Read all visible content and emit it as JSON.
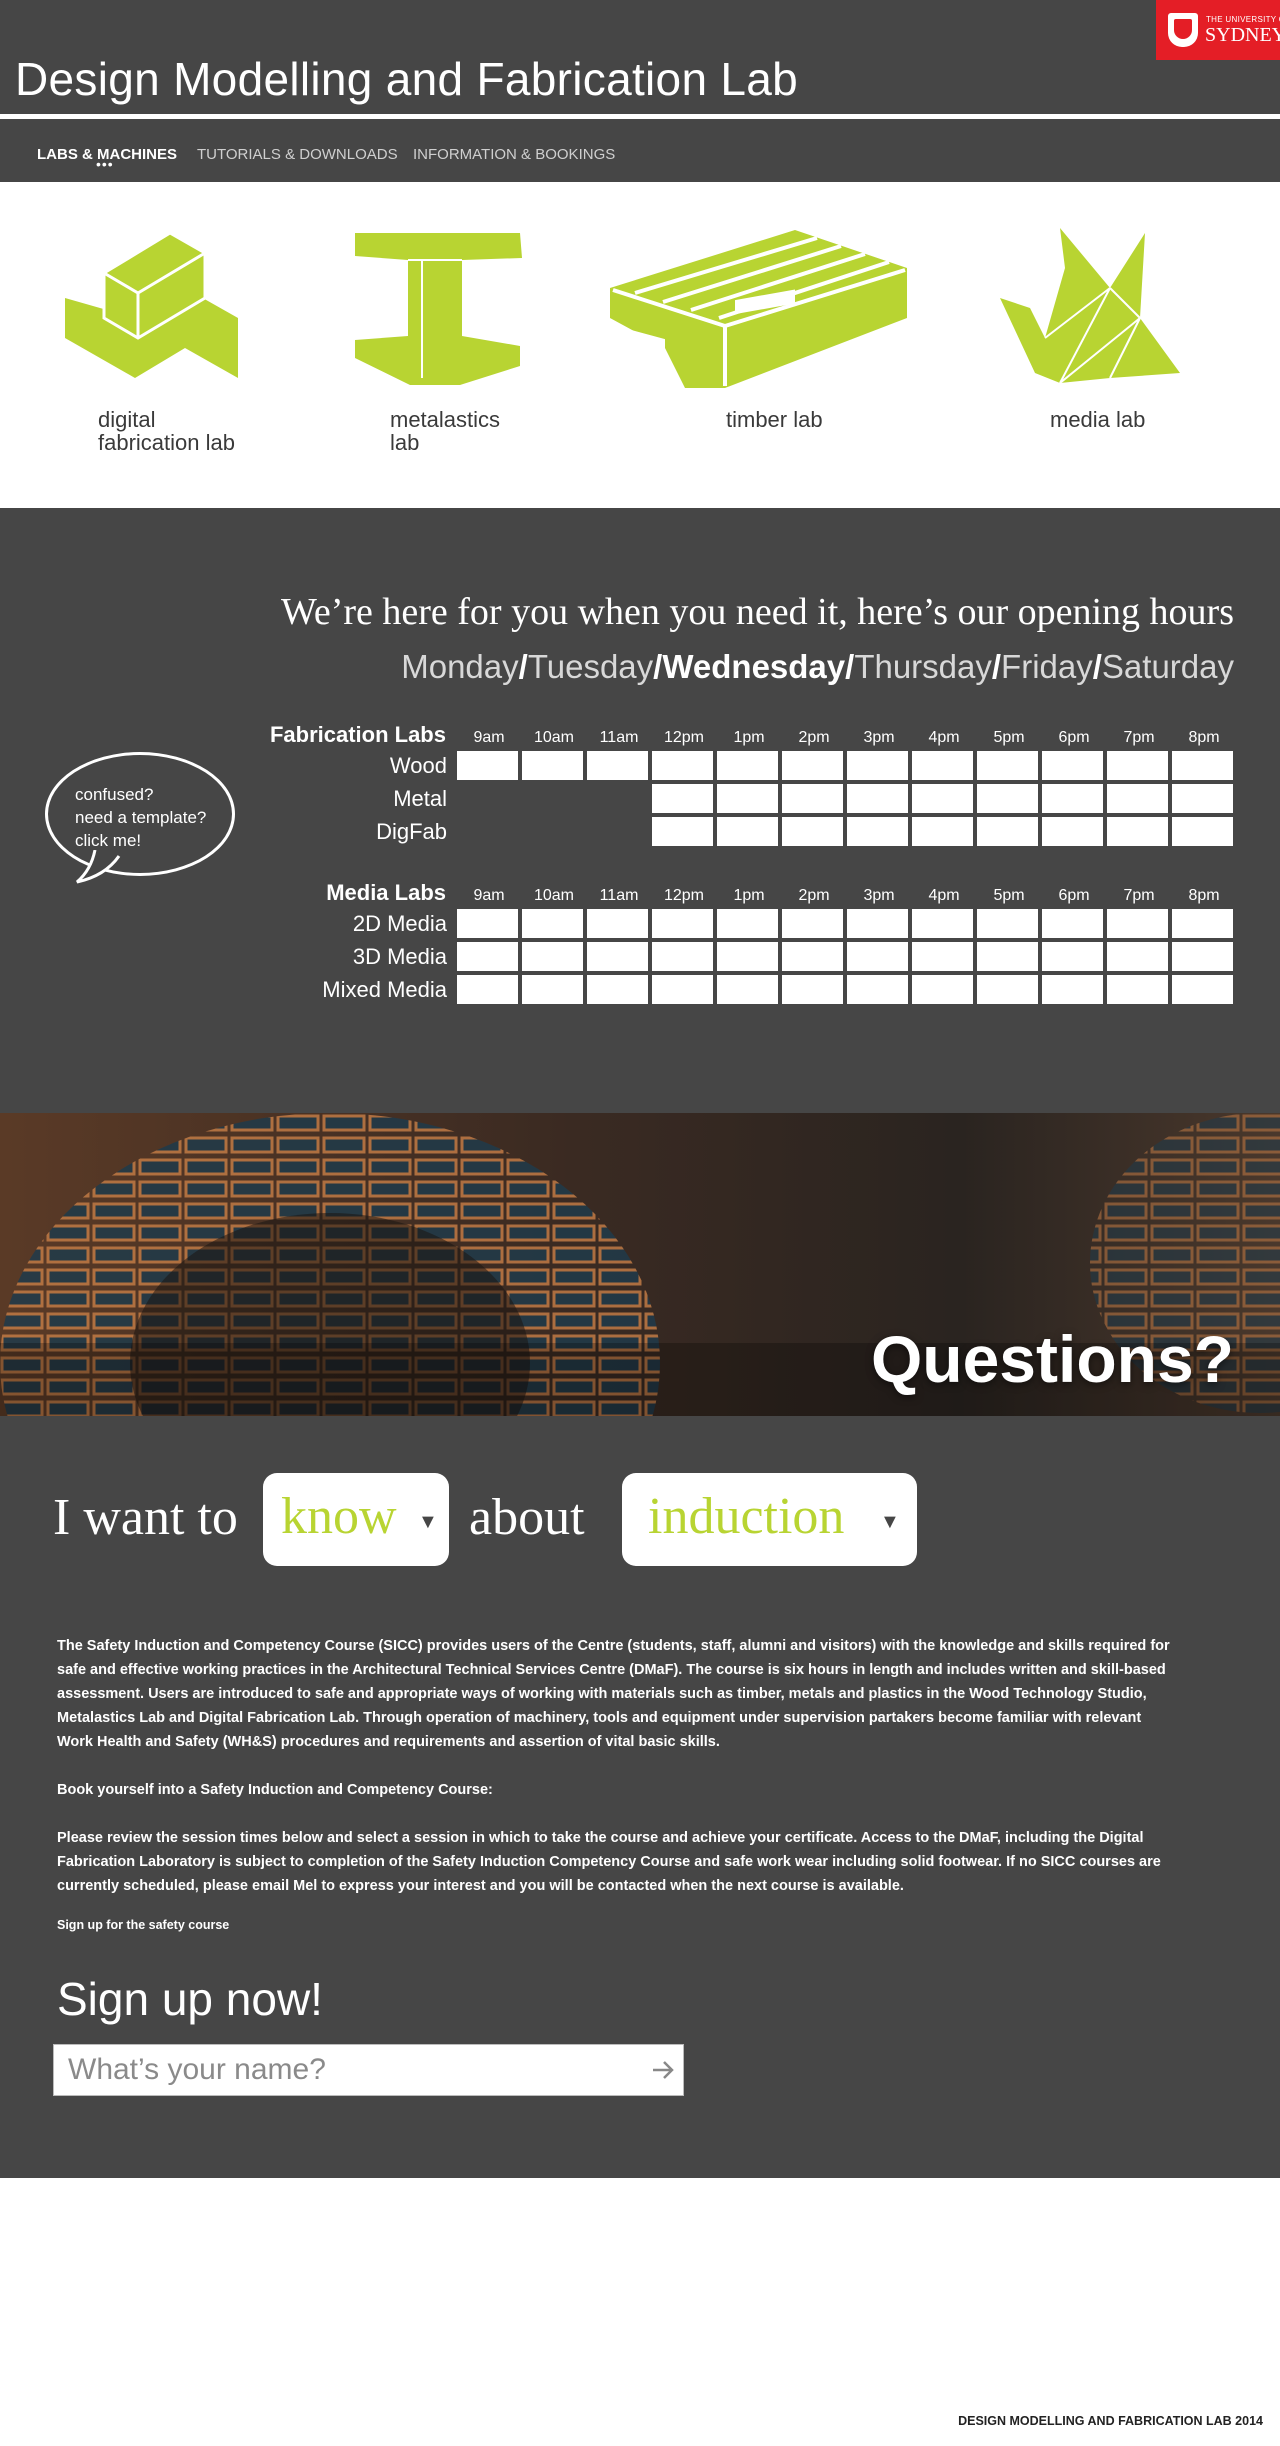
{
  "header": {
    "title": "Design Modelling and Fabrication Lab",
    "logo": {
      "small": "THE UNIVERSITY OF",
      "big": "SYDNEY"
    }
  },
  "nav": {
    "items": [
      "LABS & MACHINES",
      "TUTORIALS & DOWNLOADS",
      "INFORMATION & BOOKINGS"
    ],
    "active": "LABS & MACHINES",
    "active_marker": "•••"
  },
  "labs": [
    {
      "label_line1": "digital",
      "label_line2": "fabrication lab",
      "icon": "cubes-icon"
    },
    {
      "label_line1": "metalastics",
      "label_line2": "lab",
      "icon": "i-beam-icon"
    },
    {
      "label_line1": "timber lab",
      "label_line2": "",
      "icon": "pallet-icon"
    },
    {
      "label_line1": "media lab",
      "label_line2": "",
      "icon": "paper-crane-icon"
    }
  ],
  "hours": {
    "heading": "We’re here for you when you need it, here’s our opening hours",
    "days": [
      "Monday",
      "Tuesday",
      "Wednesday",
      "Thursday",
      "Friday",
      "Saturday"
    ],
    "separator": "/",
    "current_day": "Wednesday",
    "times": [
      "9am",
      "10am",
      "11am",
      "12pm",
      "1pm",
      "2pm",
      "3pm",
      "4pm",
      "5pm",
      "6pm",
      "7pm",
      "8pm"
    ],
    "groups": [
      {
        "title": "Fabrication Labs",
        "rows": [
          {
            "label": "Wood",
            "start_index": 0
          },
          {
            "label": "Metal",
            "start_index": 3
          },
          {
            "label": "DigFab",
            "start_index": 3
          }
        ]
      },
      {
        "title": "Media Labs",
        "rows": [
          {
            "label": "2D Media",
            "start_index": 0
          },
          {
            "label": "3D Media",
            "start_index": 0
          },
          {
            "label": "Mixed Media",
            "start_index": 0
          }
        ]
      }
    ],
    "help_bubble": "confused?\nneed a template?\nclick me!"
  },
  "banner": {
    "text": "Questions?"
  },
  "question": {
    "prefix": "I want to",
    "verb": "know",
    "middle": "about",
    "topic": "induction",
    "accent": "#b8d432"
  },
  "content": {
    "para1": "The Safety Induction and Competency Course (SICC) provides users of the Centre (students, staff, alumni and visitors) with the knowledge and skills required for safe and effective working practices in the Architectural Technical Services Centre (DMaF). The course is six hours in length and includes written and skill-based assessment. Users are introduced to safe and appropriate ways of working with materials such as timber, metals and plastics in the Wood Technology Studio, Metalastics Lab and Digital Fabrication Lab. Through operation of machinery, tools and equipment under supervision partakers become familiar with relevant Work Health and Safety (WH&S) procedures and requirements and assertion of vital basic skills.",
    "para2": "Book yourself into a Safety Induction and Competency Course:",
    "para3": "Please review the session times below and select a session in which to take the course and achieve your certificate. Access to the DMaF, including the Digital Fabrication Laboratory is subject to completion of the Safety Induction Competency Course and safe work wear including solid footwear. If no SICC courses are currently scheduled, please email Mel to express your interest and you will be contacted when the next course is available.",
    "signup_link": "Sign up for the safety course",
    "signup_title": "Sign up now!",
    "name_placeholder": "What’s your name?",
    "submit_icon": "arrow-right-icon"
  },
  "footer": {
    "text": "DESIGN MODELLING AND FABRICATION LAB 2014"
  },
  "colors": {
    "dark": "#464646",
    "accent": "#b8d432",
    "brand_red": "#e41e26"
  }
}
